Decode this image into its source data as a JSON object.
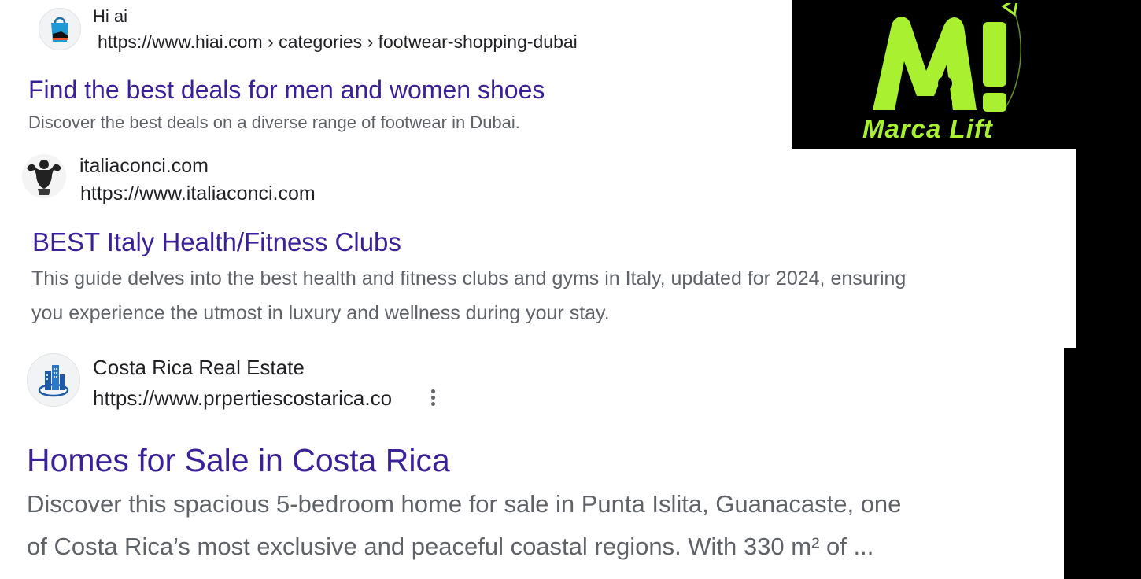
{
  "results": [
    {
      "site_name": "Hi ai",
      "url": "https://www.hiai.com › categories › footwear-shopping-dubai",
      "title": "Find the best deals for men and women shoes",
      "snippet": [
        "Discover the best deals on a diverse range of footwear in Dubai."
      ],
      "favicon": "shopping-bag-icon"
    },
    {
      "site_name": "italiaconci.com",
      "url": "https://www.italiaconci.com",
      "title": "BEST Italy Health/Fitness Clubs",
      "snippet": [
        "This guide delves into the best health and fitness clubs and gyms in Italy, updated for 2024, ensuring",
        "you experience the utmost in luxury and wellness during your stay."
      ],
      "favicon": "bodybuilder-icon"
    },
    {
      "site_name": "Costa Rica Real Estate",
      "url": "https://www.prpertiescostarica.co",
      "title": "Homes for Sale in Costa Rica",
      "snippet": [
        "Discover this spacious 5-bedroom home for sale in Punta Islita, Guanacaste, one",
        "of Costa Rica’s most exclusive and peaceful coastal regions. With 330 m² of ..."
      ],
      "favicon": "buildings-icon"
    }
  ],
  "logo": {
    "text": "Marca Lift",
    "monogram": "MI",
    "color": "#a8f030"
  },
  "colors": {
    "title_link": "#3b2199",
    "snippet": "#5f6368",
    "panel": "#000000"
  }
}
